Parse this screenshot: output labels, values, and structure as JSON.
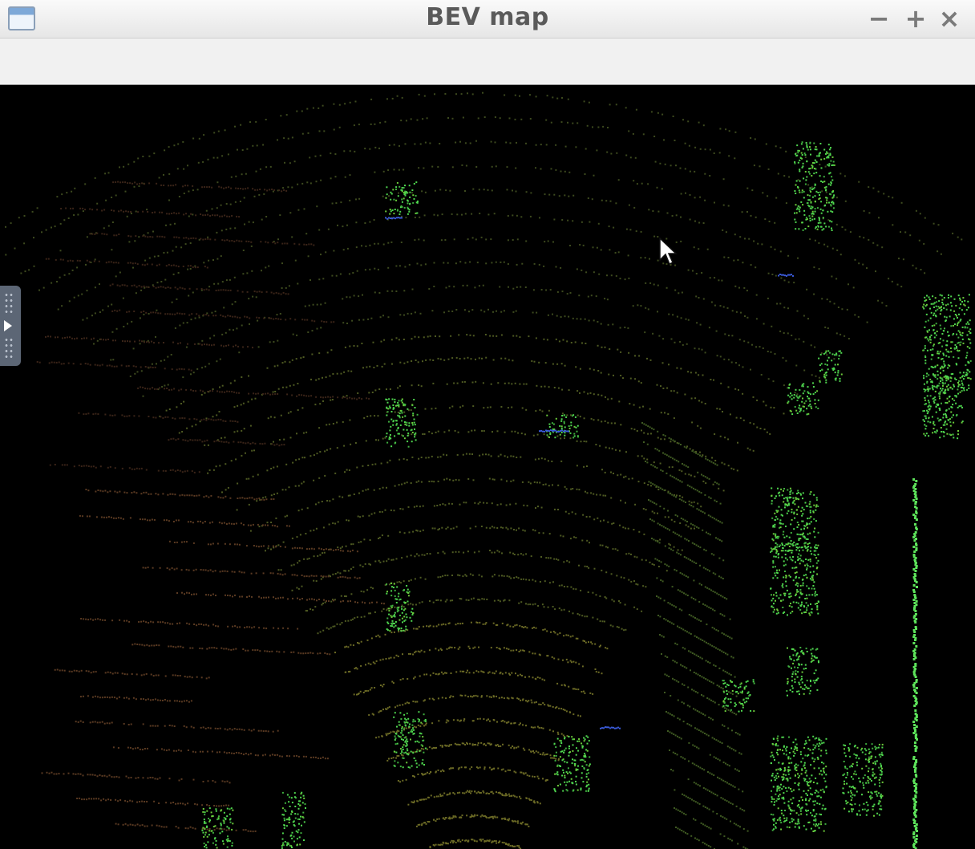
{
  "window": {
    "title": "BEV map",
    "icon": "window-app-icon",
    "controls": [
      "minimize-icon",
      "maximize-icon",
      "close-icon"
    ]
  },
  "controls": {
    "minimize": "−",
    "maximize": "+",
    "close": "×"
  },
  "colors": {
    "background": "#000000",
    "point_green": "#4fd64f",
    "point_olive": "#6b7a2a",
    "point_brown": "#5a3a2a",
    "point_blue": "#3a5ad8",
    "titlebar": "#eeeeee",
    "toolbar": "#f1f1f1"
  },
  "side_panel": {
    "icon": "expand-panel-icon"
  },
  "cursor": {
    "icon": "mouse-pointer-icon"
  }
}
